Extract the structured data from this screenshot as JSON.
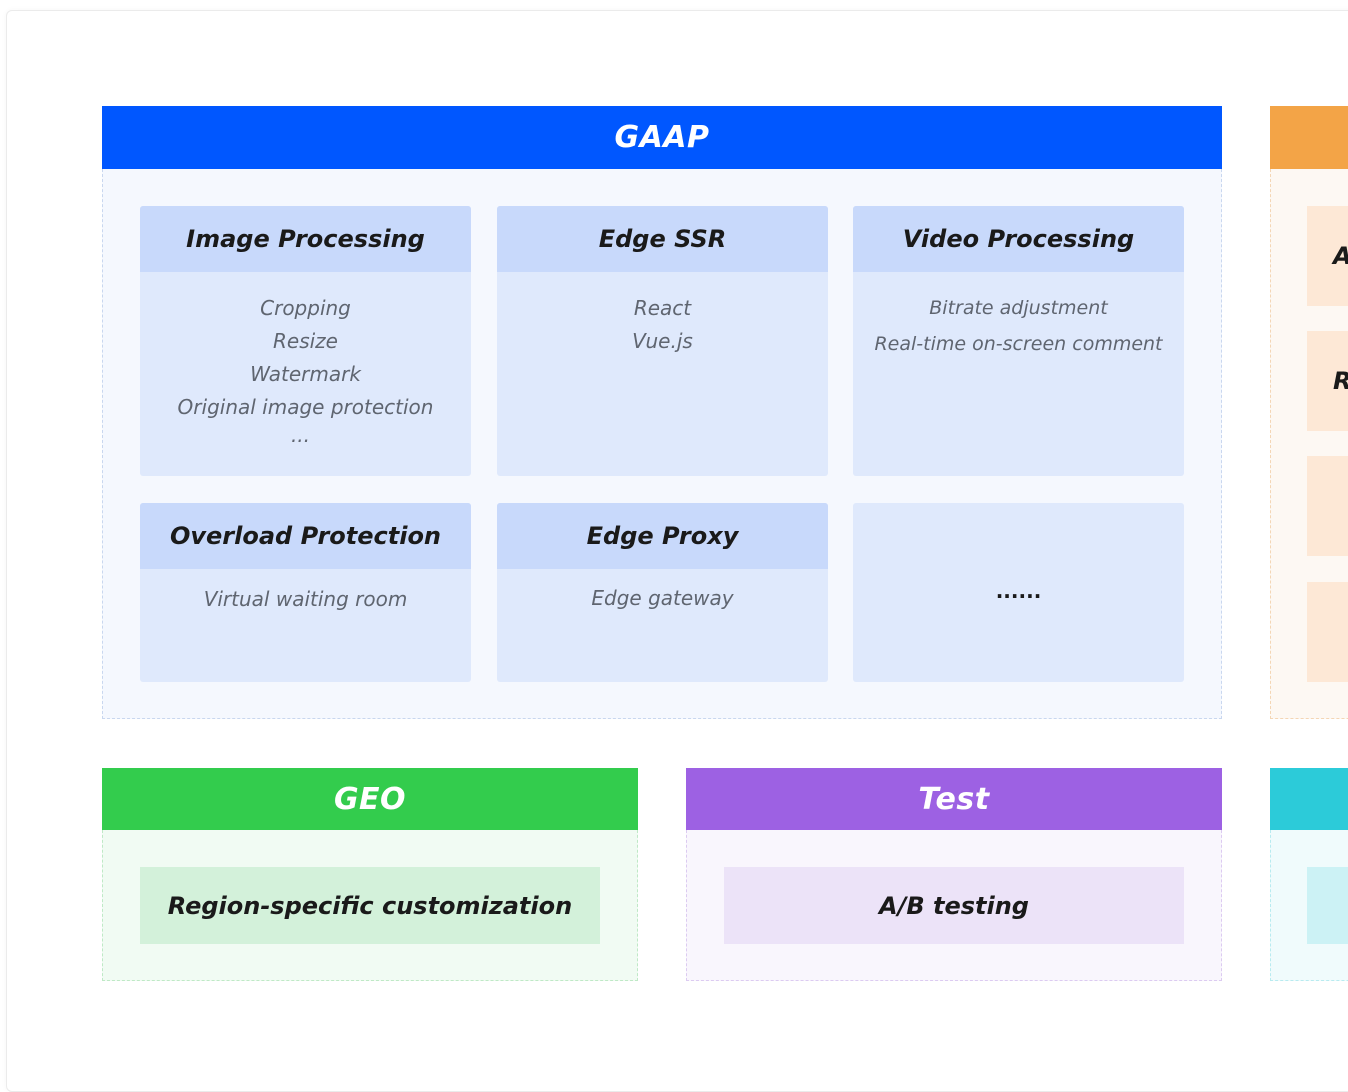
{
  "gaap": {
    "title": "GAAP",
    "color": "#0057ff",
    "cards": [
      {
        "title": "Image Processing",
        "items": [
          "Cropping",
          "Resize",
          "Watermark",
          "Original image protection",
          "..."
        ]
      },
      {
        "title": "Edge SSR",
        "items": [
          "React",
          "Vue.js"
        ]
      },
      {
        "title": "Video Processing",
        "items": [
          "Bitrate adjustment",
          "Real-time on-screen comment"
        ]
      },
      {
        "title": "Overload Protection",
        "items": [
          "Virtual waiting room"
        ]
      },
      {
        "title": "Edge Proxy",
        "items": [
          "Edge gateway"
        ]
      },
      {
        "more": "......"
      }
    ]
  },
  "right_orange": {
    "color": "#f3a447",
    "cards": [
      {
        "label": "A"
      },
      {
        "label": "R"
      },
      {
        "label": ""
      },
      {
        "label": ""
      }
    ]
  },
  "geo": {
    "title": "GEO",
    "color": "#33cc4d",
    "item": "Region-specific customization"
  },
  "test": {
    "title": "Test",
    "color": "#9d61e3",
    "item": "A/B testing"
  },
  "right_cyan": {
    "color": "#2ccbd9"
  }
}
